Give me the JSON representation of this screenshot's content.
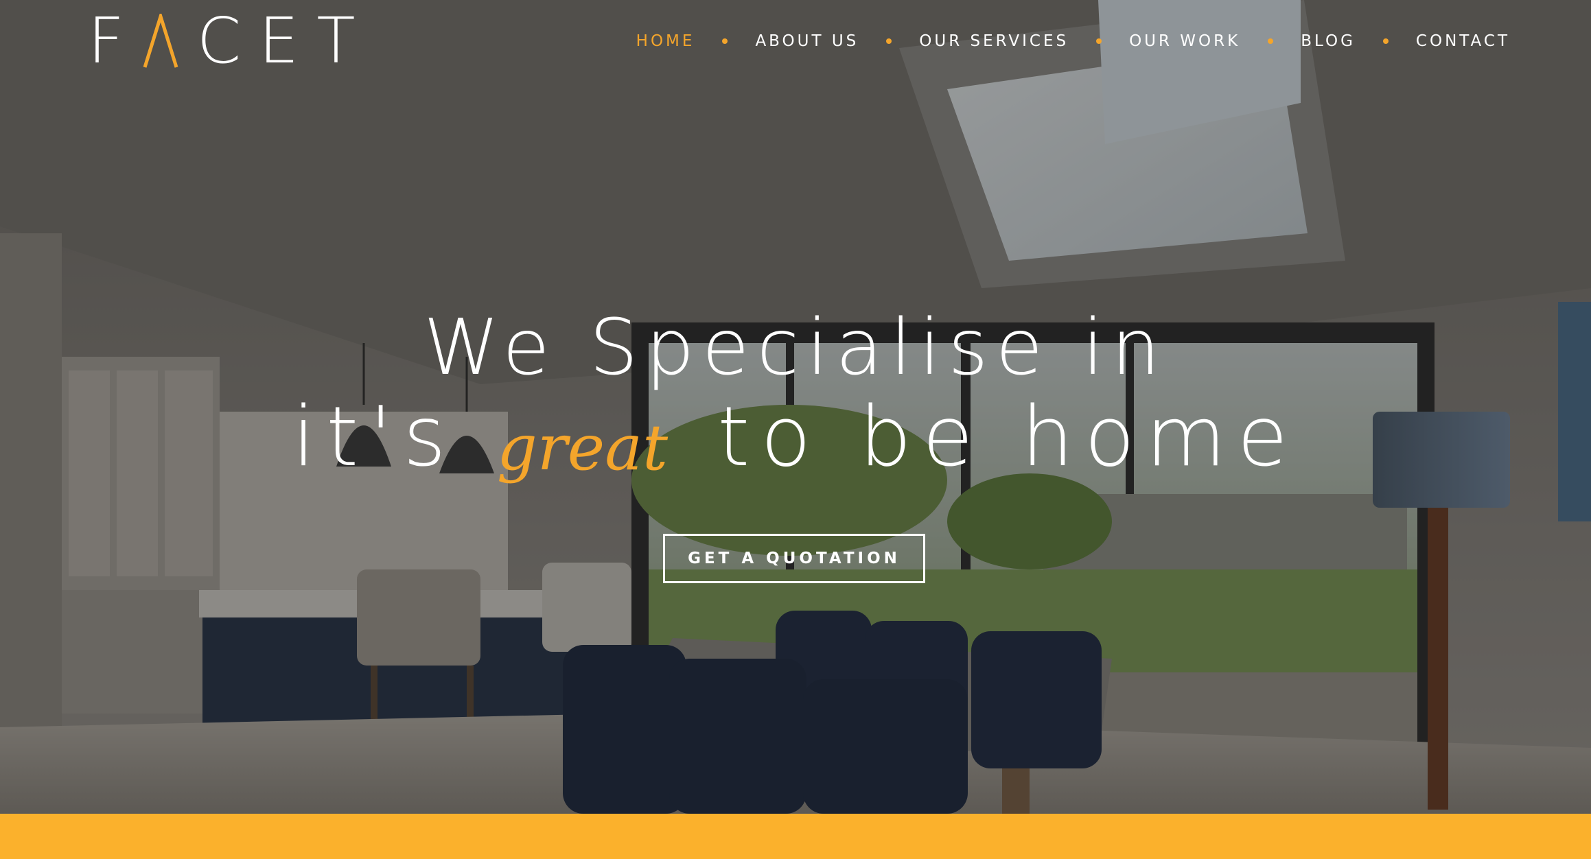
{
  "brand": {
    "logo_letters": [
      "F",
      "C",
      "E",
      "T"
    ],
    "logo_a_icon": "chevron-a-icon",
    "accent_color": "#f4a52b",
    "band_color": "#fbb12c"
  },
  "nav": {
    "items": [
      {
        "label": "HOME",
        "active": true
      },
      {
        "label": "ABOUT US",
        "active": false
      },
      {
        "label": "OUR SERVICES",
        "active": false
      },
      {
        "label": "OUR WORK",
        "active": false
      },
      {
        "label": "BLOG",
        "active": false
      },
      {
        "label": "CONTACT",
        "active": false
      }
    ],
    "separator_icon": "dot-icon"
  },
  "hero": {
    "line1": "We Specialise in",
    "line2_before": "it's",
    "line2_script": "great",
    "line2_after": "to be home",
    "cta_label": "GET A QUOTATION"
  }
}
